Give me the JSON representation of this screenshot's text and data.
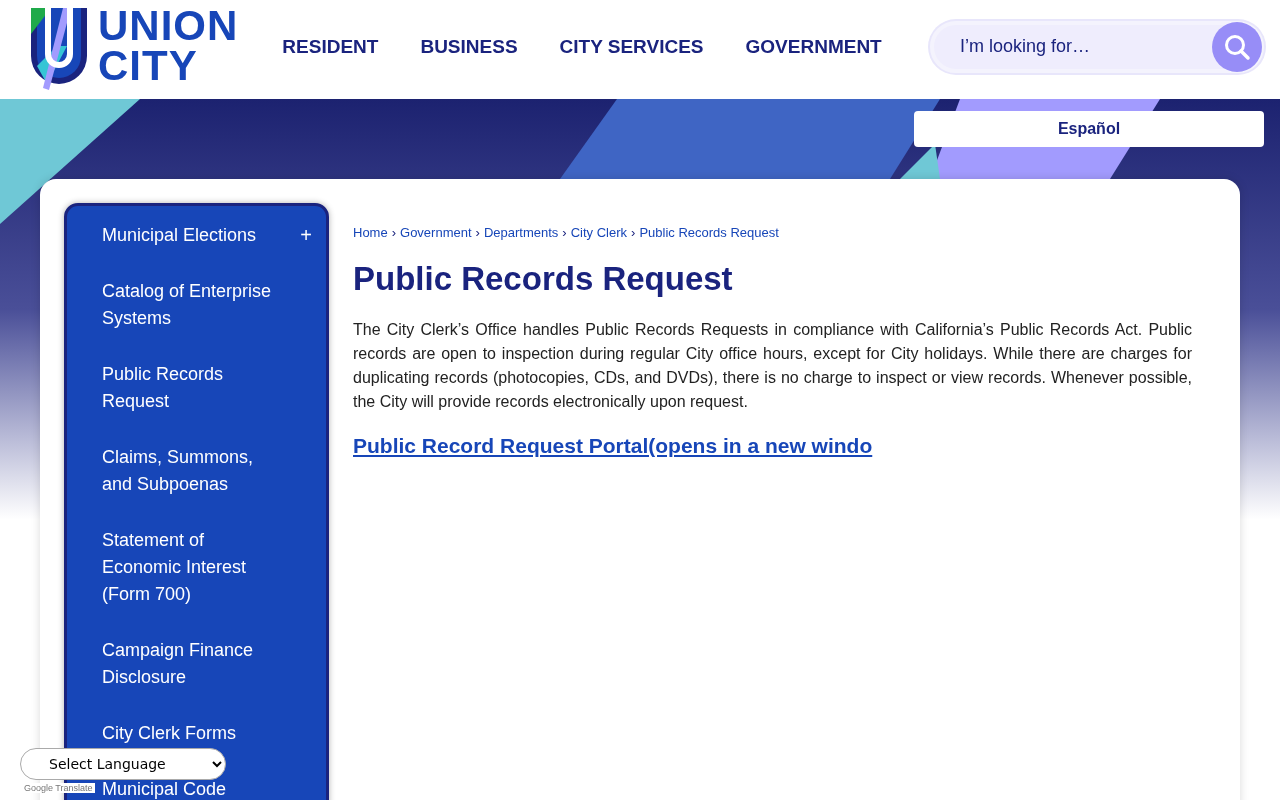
{
  "logo": {
    "line_1": "UNION",
    "line_2": "CITY"
  },
  "nav": [
    {
      "label": "RESIDENT"
    },
    {
      "label": "BUSINESS"
    },
    {
      "label": "CITY SERVICES"
    },
    {
      "label": "GOVERNMENT"
    }
  ],
  "search": {
    "placeholder": "I’m looking for…"
  },
  "language_button": "Español",
  "sidebar": {
    "items": [
      {
        "label": "Municipal Elections",
        "toggle": "+"
      },
      {
        "label": "Catalog of Enterprise Systems"
      },
      {
        "label": "Public Records Request"
      },
      {
        "label": "Claims, Summons, and Subpoenas"
      },
      {
        "label": "Statement of Economic Interest (Form 700)"
      },
      {
        "label": "Campaign Finance Disclosure"
      },
      {
        "label": "City Clerk Forms"
      },
      {
        "label": "Municipal Code"
      }
    ]
  },
  "breadcrumb": {
    "separator": "›",
    "items": [
      "Home",
      "Government",
      "Departments",
      "City Clerk",
      "Public Records Request"
    ]
  },
  "title": "Public Records Request",
  "body": "The City Clerk’s Office handles Public Records Requests in compliance with California’s Public Records Act. Public records are open to inspection during regular City office hours, except for City holidays. While there are charges for duplicating records (photocopies, CDs, and DVDs), there is no charge to inspect or view records. Whenever possible, the City will provide records electronically upon request.",
  "link": "Public Record Request Portal(opens in a new windo",
  "translate": {
    "select": "Select Language",
    "credit": "Google Translate"
  }
}
